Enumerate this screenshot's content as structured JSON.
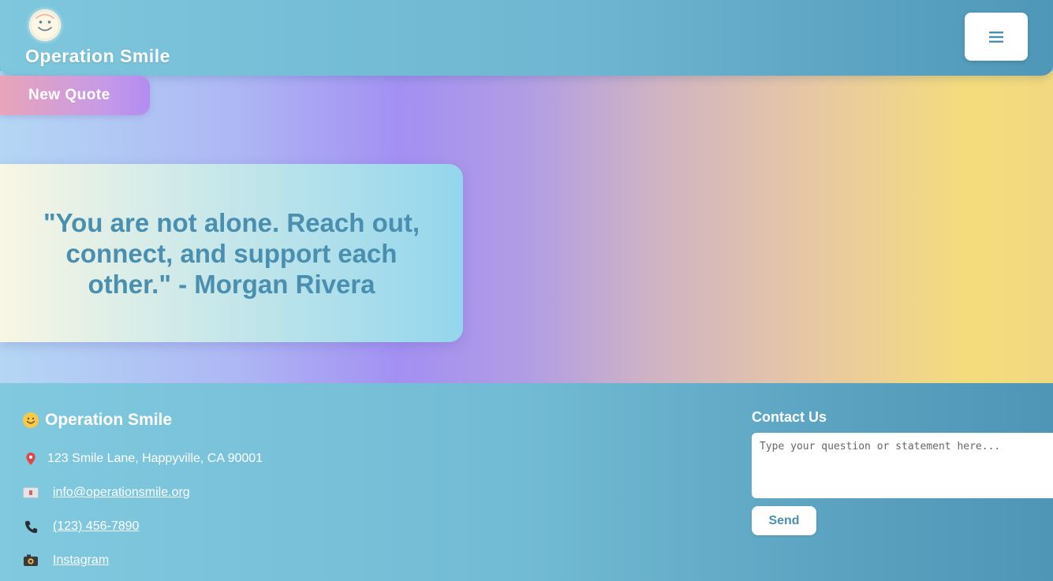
{
  "header": {
    "brand": "Operation Smile",
    "logo_icon": "smiley-face-icon",
    "menu_icon": "hamburger-menu-icon"
  },
  "hero": {
    "new_quote_label": "New Quote",
    "quote": "\"You are not alone. Reach out, connect, and support each other.\" - Morgan Rivera"
  },
  "footer": {
    "brand": "Operation Smile",
    "brand_icon": "smiley-emoji-icon",
    "address": "123 Smile Lane, Happyville, CA 90001",
    "email": "info@operationsmile.org",
    "phone": "(123) 456-7890",
    "instagram": "Instagram",
    "contact": {
      "title": "Contact Us",
      "placeholder": "Type your question or statement here...",
      "send_label": "Send"
    }
  },
  "colors": {
    "accent_text": "#4a8fb0",
    "header_start": "#7ec7dd",
    "header_end": "#4f97b8",
    "hero_purple": "#a390f2",
    "hero_yellow": "#f4dc7c"
  }
}
